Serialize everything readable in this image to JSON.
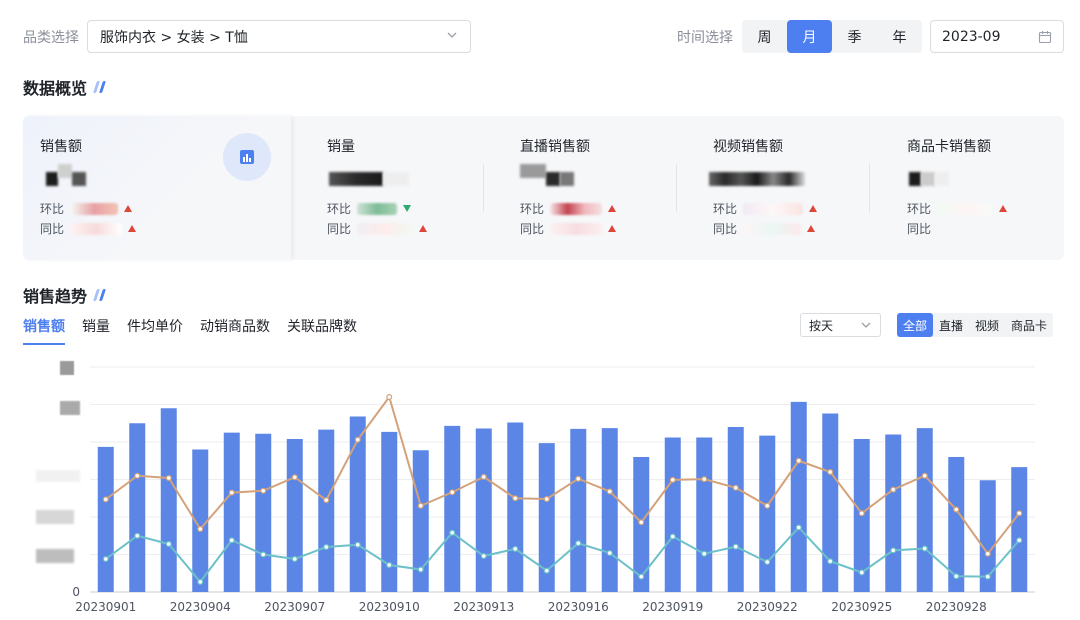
{
  "filters": {
    "category_label": "品类选择",
    "category_value": "服饰内衣 > 女装 > T恤",
    "time_label": "时间选择",
    "periods": [
      "周",
      "月",
      "季",
      "年"
    ],
    "active_period": "月",
    "date_value": "2023-09"
  },
  "overview": {
    "title": "数据概览",
    "compare_labels": {
      "mom": "环比",
      "yoy": "同比"
    },
    "kpis": [
      {
        "name": "销售额",
        "mom_dir": "up",
        "yoy_dir": "up"
      },
      {
        "name": "销量",
        "mom_dir": "down",
        "yoy_dir": "up"
      },
      {
        "name": "直播销售额",
        "mom_dir": "up",
        "yoy_dir": "up"
      },
      {
        "name": "视频销售额",
        "mom_dir": "up",
        "yoy_dir": "up"
      },
      {
        "name": "商品卡销售额",
        "mom_dir": "up",
        "yoy_dir": ""
      }
    ]
  },
  "trend": {
    "title": "销售趋势",
    "tabs": [
      "销售额",
      "销量",
      "件均单价",
      "动销商品数",
      "关联品牌数"
    ],
    "active_tab": "销售额",
    "granularity": "按天",
    "channels": [
      "全部",
      "直播",
      "视频",
      "商品卡"
    ],
    "active_channel": "全部"
  },
  "chart_data": {
    "type": "bar",
    "x": [
      "20230901",
      "20230902",
      "20230903",
      "20230904",
      "20230905",
      "20230906",
      "20230907",
      "20230908",
      "20230909",
      "20230910",
      "20230911",
      "20230912",
      "20230913",
      "20230914",
      "20230915",
      "20230916",
      "20230917",
      "20230918",
      "20230919",
      "20230920",
      "20230921",
      "20230922",
      "20230923",
      "20230924",
      "20230925",
      "20230926",
      "20230927",
      "20230928",
      "20230929",
      "20230930"
    ],
    "x_tick_labels": [
      "20230901",
      "20230904",
      "20230907",
      "20230910",
      "20230913",
      "20230916",
      "20230919",
      "20230922",
      "20230925",
      "20230928"
    ],
    "y_tick_labels": [
      "0"
    ],
    "ylim": [
      0,
      6
    ],
    "grid": true,
    "series": [
      {
        "type": "bar",
        "color": "#5b86e5",
        "values": [
          3.87,
          4.5,
          4.9,
          3.8,
          4.25,
          4.22,
          4.08,
          4.33,
          4.68,
          4.27,
          3.78,
          4.43,
          4.36,
          4.52,
          3.97,
          4.35,
          4.37,
          3.6,
          4.12,
          4.12,
          4.4,
          4.17,
          5.07,
          4.76,
          4.08,
          4.2,
          4.37,
          3.6,
          2.98,
          3.33
        ]
      },
      {
        "type": "line",
        "color": "#d4a27a",
        "values": [
          2.47,
          3.1,
          3.04,
          1.68,
          2.65,
          2.7,
          3.06,
          2.45,
          4.06,
          5.2,
          2.3,
          2.66,
          3.07,
          2.5,
          2.48,
          3.02,
          2.68,
          1.86,
          2.99,
          3.01,
          2.78,
          2.3,
          3.5,
          3.2,
          2.1,
          2.73,
          3.1,
          2.2,
          1.02,
          2.1
        ]
      },
      {
        "type": "line",
        "color": "#6cc1c9",
        "values": [
          0.88,
          1.5,
          1.28,
          0.27,
          1.38,
          1.0,
          0.88,
          1.2,
          1.26,
          0.72,
          0.6,
          1.58,
          0.96,
          1.15,
          0.57,
          1.3,
          1.04,
          0.41,
          1.48,
          1.02,
          1.21,
          0.8,
          1.72,
          0.82,
          0.52,
          1.11,
          1.16,
          0.42,
          0.41,
          1.38
        ]
      }
    ]
  }
}
